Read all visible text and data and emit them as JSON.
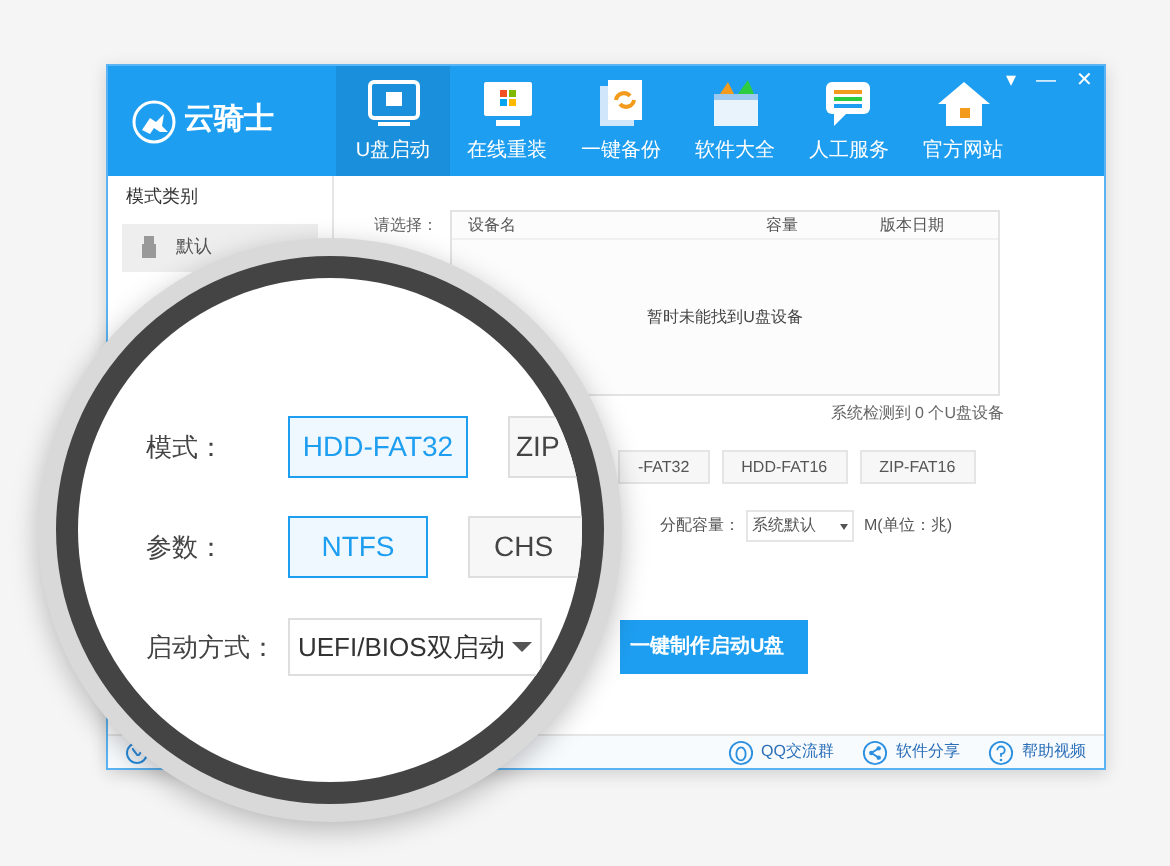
{
  "app": {
    "logo": "云骑士",
    "window_controls": [
      "▾",
      "—",
      "✕"
    ]
  },
  "nav": [
    {
      "label": "U盘启动",
      "selected": true
    },
    {
      "label": "在线重装",
      "selected": false
    },
    {
      "label": "一键备份",
      "selected": false
    },
    {
      "label": "软件大全",
      "selected": false
    },
    {
      "label": "人工服务",
      "selected": false
    },
    {
      "label": "官方网站",
      "selected": false
    }
  ],
  "sidebar": {
    "title": "模式类别",
    "items": [
      {
        "label": "默认",
        "selected": true
      }
    ]
  },
  "device_table": {
    "label": "请选择：",
    "columns": [
      "设备名",
      "容量",
      "版本日期"
    ],
    "empty_text": "暂时未能找到U盘设备",
    "status": "系统检测到 0 个U盘设备"
  },
  "window_modes": [
    "-FAT32",
    "HDD-FAT16",
    "ZIP-FAT16"
  ],
  "capacity": {
    "label": "分配容量：",
    "value": "系统默认",
    "unit": "M(单位：兆)"
  },
  "make_button": "一键制作启动U盘",
  "footer": {
    "links": [
      {
        "label": "QQ交流群"
      },
      {
        "label": "软件分享"
      },
      {
        "label": "帮助视频"
      }
    ]
  },
  "magnifier": {
    "rows": [
      {
        "label": "模式：",
        "kind": "buttons",
        "options": [
          {
            "label": "HDD-FAT32",
            "selected": true
          },
          {
            "label": "ZIP",
            "selected": false
          }
        ]
      },
      {
        "label": "参数：",
        "kind": "buttons",
        "options": [
          {
            "label": "NTFS",
            "selected": true
          },
          {
            "label": "CHS",
            "selected": false
          }
        ]
      },
      {
        "label": "启动方式：",
        "kind": "select",
        "value": "UEFI/BIOS双启动"
      }
    ]
  }
}
